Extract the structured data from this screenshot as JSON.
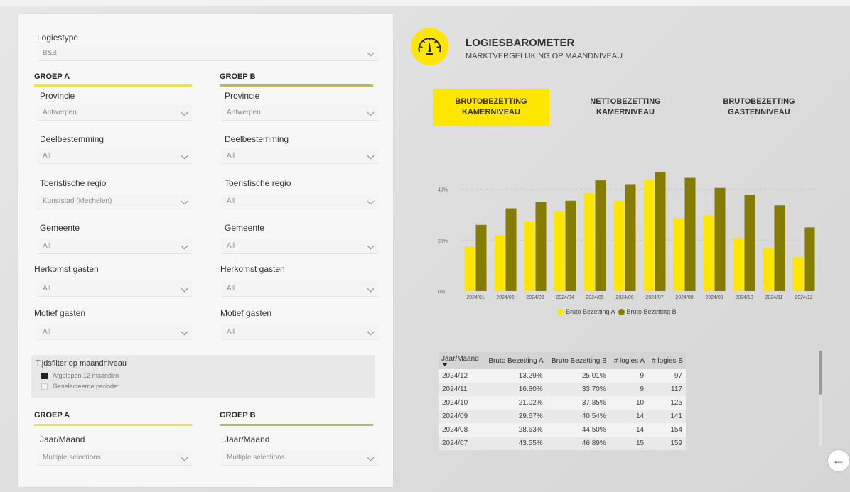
{
  "filters": {
    "logiestype": {
      "label": "Logiestype",
      "value": "B&B"
    },
    "groups": [
      "GROEP A",
      "GROEP B"
    ],
    "group_a": {
      "provincie": {
        "label": "Provincie",
        "value": "Antwerpen"
      },
      "deelbestemming": {
        "label": "Deelbestemming",
        "value": "All"
      },
      "regio": {
        "label": "Toeristische regio",
        "value": "Kunststad (Mechelen)"
      },
      "gemeente": {
        "label": "Gemeente",
        "value": "All"
      },
      "herkomst": {
        "label": "Herkomst gasten",
        "value": "All"
      },
      "motief": {
        "label": "Motief gasten",
        "value": "All"
      }
    },
    "group_b": {
      "provincie": {
        "label": "Provincie",
        "value": "Antwerpen"
      },
      "deelbestemming": {
        "label": "Deelbestemming",
        "value": "All"
      },
      "regio": {
        "label": "Toeristische regio",
        "value": "All"
      },
      "gemeente": {
        "label": "Gemeente",
        "value": "All"
      },
      "herkomst": {
        "label": "Herkomst gasten",
        "value": "All"
      },
      "motief": {
        "label": "Motief gasten",
        "value": "All"
      }
    },
    "time": {
      "title": "Tijdsfilter op maandniveau",
      "options": [
        {
          "label": "Afgelopen 12 maanden",
          "checked": true
        },
        {
          "label": "Geselecteerde periode:",
          "checked": false
        }
      ]
    },
    "period": {
      "groups": [
        "GROEP A",
        "GROEP B"
      ],
      "a": {
        "label": "Jaar/Maand",
        "value": "Multiple selections"
      },
      "b": {
        "label": "Jaar/Maand",
        "value": "Multiple selections"
      }
    }
  },
  "header": {
    "title": "LOGIESBAROMETER",
    "subtitle": "MARKTVERGELIJKING OP MAANDNIVEAU"
  },
  "tabs": [
    {
      "line1": "BRUTOBEZETTING",
      "line2": "KAMERNIVEAU",
      "active": true
    },
    {
      "line1": "NETTOBEZETTING",
      "line2": "KAMERNIVEAU",
      "active": false
    },
    {
      "line1": "BRUTOBEZETTING",
      "line2": "GASTENNIVEAU",
      "active": false
    }
  ],
  "colors": {
    "series_a": "#ffe600",
    "series_b": "#857c00",
    "accent": "#ffe600"
  },
  "chart_data": {
    "type": "bar",
    "categories": [
      "2024/01",
      "2024/02",
      "2024/03",
      "2024/04",
      "2024/05",
      "2024/06",
      "2024/07",
      "2024/08",
      "2024/09",
      "2024/10",
      "2024/11",
      "2024/12"
    ],
    "series": [
      {
        "name": "Bruto Bezetting A",
        "values": [
          17.5,
          22.0,
          27.5,
          31.5,
          38.5,
          35.5,
          43.55,
          28.63,
          29.67,
          21.02,
          16.8,
          13.29
        ]
      },
      {
        "name": "Bruto Bezetting B",
        "values": [
          26.0,
          32.5,
          35.0,
          35.5,
          43.5,
          42.0,
          46.89,
          44.5,
          40.54,
          37.85,
          33.7,
          25.01
        ]
      }
    ],
    "yticks": [
      "0%",
      "20%",
      "40%"
    ],
    "ylim": [
      0,
      48
    ],
    "grid": true,
    "legend": "bottom"
  },
  "table": {
    "headers": [
      "Jaar/Maand",
      "Bruto Bezetting A",
      "Bruto Bezetting B",
      "# logies A",
      "# logies B"
    ],
    "rows": [
      [
        "2024/12",
        "13.29%",
        "25.01%",
        "9",
        "97"
      ],
      [
        "2024/11",
        "16.80%",
        "33.70%",
        "9",
        "117"
      ],
      [
        "2024/10",
        "21.02%",
        "37.85%",
        "10",
        "125"
      ],
      [
        "2024/09",
        "29.67%",
        "40.54%",
        "14",
        "141"
      ],
      [
        "2024/08",
        "28.63%",
        "44.50%",
        "14",
        "154"
      ],
      [
        "2024/07",
        "43.55%",
        "46.89%",
        "15",
        "159"
      ]
    ]
  },
  "nav": {
    "back_icon": "←"
  }
}
